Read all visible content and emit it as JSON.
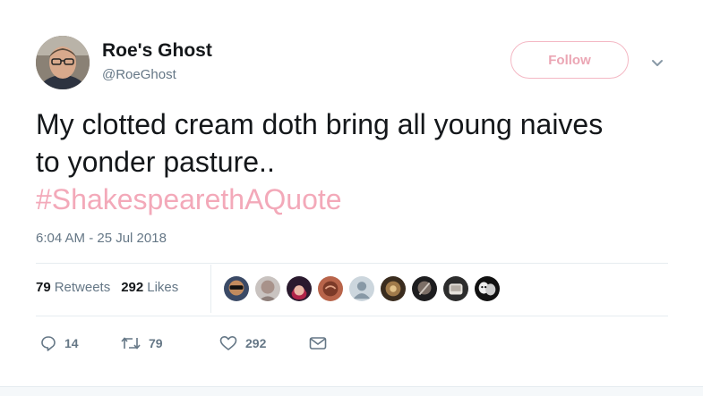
{
  "user": {
    "display_name": "Roe's Ghost",
    "handle": "@RoeGhost"
  },
  "follow_button": {
    "label": "Follow"
  },
  "tweet": {
    "text_line1": "My clotted cream doth bring all young naives",
    "text_line2": "to yonder pasture..",
    "hashtag": "#ShakespearethAQuote",
    "timestamp": "6:04 AM - 25 Jul 2018"
  },
  "stats": {
    "retweets_count": "79",
    "retweets_label": "Retweets",
    "likes_count": "292",
    "likes_label": "Likes"
  },
  "actions": {
    "reply_count": "14",
    "retweet_count": "79",
    "like_count": "292"
  },
  "colors": {
    "accent": "#f4b8c4",
    "hashtag": "#f3a9b9",
    "text": "#14171a",
    "muted": "#657786",
    "divider": "#e6ecf0"
  },
  "icons": [
    "reply-icon",
    "retweet-icon",
    "heart-icon",
    "message-icon",
    "chevron-down-icon"
  ]
}
